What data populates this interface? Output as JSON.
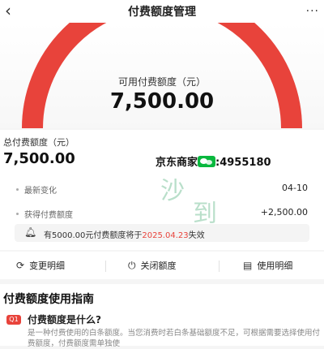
{
  "header": {
    "back_icon": "chevron-left-icon",
    "title": "付费额度管理",
    "more_label": "..."
  },
  "hero": {
    "available_label": "可用付费额度（元）",
    "available_value": "7,500.00",
    "gauge_fill_fraction": 1.0,
    "gauge_color": "#e8433b"
  },
  "summary": {
    "total_label": "总付费额度（元）",
    "total_value": "7,500.00",
    "promo_prefix": "京东商家",
    "promo_suffix": ":4955180"
  },
  "details": [
    {
      "label": "最新变化",
      "value": "04-10"
    },
    {
      "label": "获得付费额度",
      "value": "+2,500.00"
    }
  ],
  "notice": {
    "text_before": "有5000.00元付费额度将于",
    "date": "2025.04.23",
    "text_after": "失效"
  },
  "actions": [
    {
      "label": "变更明细",
      "icon": "refresh-icon"
    },
    {
      "label": "关闭额度",
      "icon": "power-icon"
    },
    {
      "label": "使用明细",
      "icon": "document-icon"
    }
  ],
  "guide": {
    "title": "付费额度使用指南",
    "question_badge": "Q1",
    "question": "付费额度是什么?",
    "answer": "是一种付费使用的白条额度。当您消费时若白条基础额度不足，可根据需要选择使用付费额度，付费额度需单独使"
  },
  "colors": {
    "accent": "#e8433b",
    "wechat": "#09b83e"
  }
}
